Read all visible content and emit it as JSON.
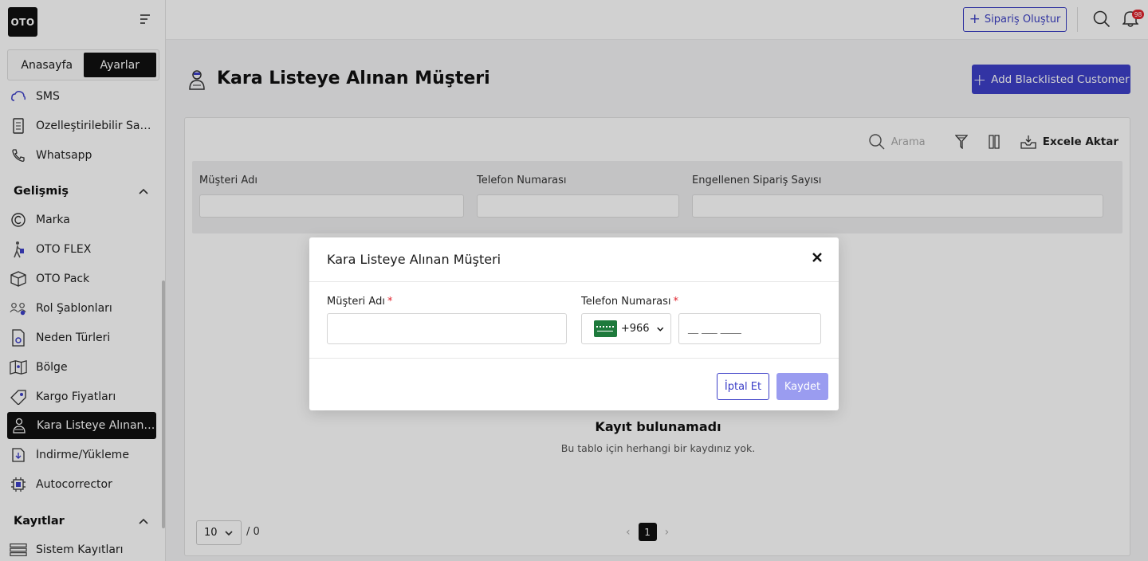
{
  "app": {
    "logo_text": "OTO"
  },
  "sidebar": {
    "tabs": [
      {
        "label": "Anasayfa"
      },
      {
        "label": "Ayarlar"
      }
    ],
    "items_top": [
      {
        "label": "SMS",
        "icon": "cloud-icon"
      },
      {
        "label": "Özelleştirilebilir Sayfalar",
        "icon": "page-icon"
      },
      {
        "label": "Whatsapp",
        "icon": "phone-icon"
      }
    ],
    "section_advanced": "Gelişmiş",
    "items_advanced": [
      {
        "label": "Marka",
        "icon": "copyright-icon"
      },
      {
        "label": "OTO FLEX",
        "icon": "walker-icon"
      },
      {
        "label": "OTO Pack",
        "icon": "box-icon"
      },
      {
        "label": "Rol Şablonları",
        "icon": "users-icon"
      },
      {
        "label": "Neden Türleri",
        "icon": "document-gear-icon"
      },
      {
        "label": "Bölge",
        "icon": "map-icon"
      },
      {
        "label": "Kargo Fiyatları",
        "icon": "tag-icon"
      },
      {
        "label": "Kara Listeye Alınan Müşteri",
        "icon": "blacklist-user-icon",
        "selected": true
      },
      {
        "label": "İndirme/Yükleme",
        "icon": "download-icon"
      },
      {
        "label": "Autocorrector",
        "icon": "chip-icon"
      }
    ],
    "section_logs": "Kayıtlar",
    "items_logs": [
      {
        "label": "Sistem Kayıtları",
        "icon": "server-icon"
      }
    ]
  },
  "topbar": {
    "create_order_label": "Sipariş Oluştur",
    "notification_count": "98"
  },
  "page": {
    "title": "Kara Listeye Alınan Müşteri",
    "add_button_label": "Add Blacklisted Customer",
    "search_placeholder": "Arama",
    "export_label": "Excele Aktar",
    "filters": [
      {
        "label": "Müşteri Adı"
      },
      {
        "label": "Telefon Numarası"
      },
      {
        "label": "Engellenen Sipariş Sayısı"
      }
    ],
    "empty_title": "Kayıt bulunamadı",
    "empty_subtitle": "Bu tablo için herhangi bir kaydınız yok.",
    "page_size": "10",
    "total": "/ 0",
    "current_page": "1"
  },
  "modal": {
    "title": "Kara Listeye Alınan Müşteri",
    "name_label": "Müşteri Adı",
    "phone_label": "Telefon Numarası",
    "required_mark": "*",
    "country_code": "+966",
    "phone_placeholder": "__ ___ ____",
    "cancel_label": "İptal Et",
    "save_label": "Kaydet"
  },
  "colors": {
    "accent": "#3d40c8",
    "save_disabled": "#9a9cf0",
    "required": "#e0242e"
  }
}
